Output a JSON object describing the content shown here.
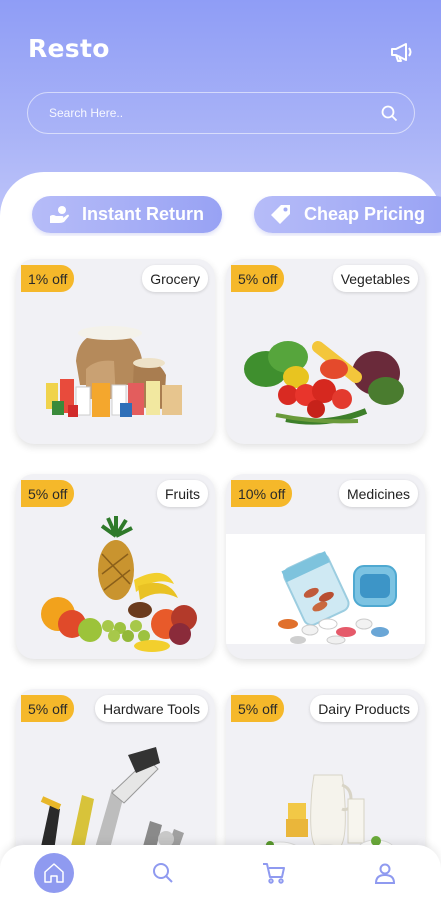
{
  "header": {
    "title": "Resto",
    "icon": "megaphone-icon"
  },
  "search": {
    "placeholder": "Search Here.."
  },
  "chips": [
    {
      "label": "Instant Return",
      "icon": "hand-return-icon"
    },
    {
      "label": "Cheap Pricing",
      "icon": "price-tag-icon"
    }
  ],
  "categories": [
    {
      "discount": "1% off",
      "name": "Grocery"
    },
    {
      "discount": "5% off",
      "name": "Vegetables"
    },
    {
      "discount": "5% off",
      "name": "Fruits"
    },
    {
      "discount": "10% off",
      "name": "Medicines"
    },
    {
      "discount": "5% off",
      "name": "Hardware Tools"
    },
    {
      "discount": "5% off",
      "name": "Dairy Products"
    }
  ],
  "nav": {
    "items": [
      "home-icon",
      "search-icon",
      "cart-icon",
      "profile-icon"
    ],
    "active": "home-icon"
  },
  "colors": {
    "accent": "#8f9df6",
    "badge": "#f5b82a",
    "card": "#f1f1f5"
  }
}
